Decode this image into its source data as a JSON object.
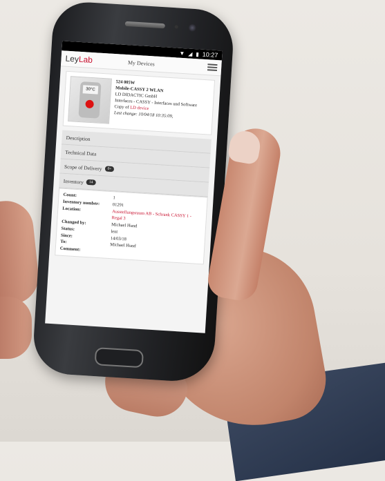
{
  "status": {
    "time": "10:27"
  },
  "app": {
    "logo_ley": "Ley",
    "logo_lab": "Lab",
    "title": "My Devices"
  },
  "device": {
    "number": "524 005W",
    "name": "Mobile-CASSY 2 WLAN",
    "maker": "LD DIDACTIC GmbH",
    "category": "Interfaces - CASSY - Interfaces und Software",
    "copy_prefix": "Copy of",
    "copy_link": "LD device",
    "last_change": "Last change: 10/04/18 10:35:09,",
    "display_text": "30°C"
  },
  "accordion": [
    {
      "label": "Description",
      "badge": ""
    },
    {
      "label": "Technical Data",
      "badge": ""
    },
    {
      "label": "Scope of Delivery",
      "badge": "0+"
    },
    {
      "label": "Inventory",
      "badge": "14"
    }
  ],
  "inventory": {
    "count_label": "Count:",
    "count_value": "1",
    "number_label": "Inventory number:",
    "number_value": "01291",
    "location_label": "Location:",
    "location_value": "Ausstellungsraum AB - Schrank CASSY 1 - Regal 3",
    "changed_label": "Changed by:",
    "changed_value": "Michael Hund",
    "status_label": "Status:",
    "status_value": "lent",
    "since_label": "Since:",
    "since_value": "14/03/18",
    "to_label": "To:",
    "to_value": "Michael Hund",
    "comment_label": "Comment:",
    "comment_value": ""
  },
  "colors": {
    "brand": "#c8102e"
  }
}
